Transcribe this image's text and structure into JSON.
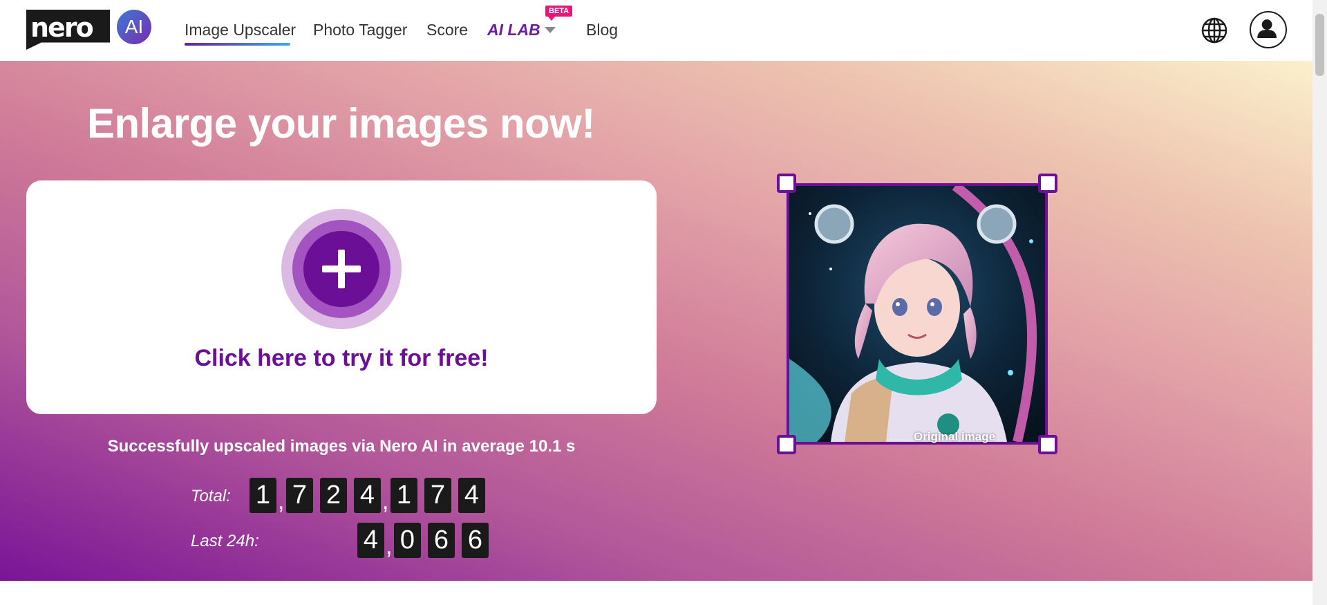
{
  "header": {
    "logo_text": "nero",
    "logo_ai": "AI",
    "nav": {
      "upscaler": "Image Upscaler",
      "tagger": "Photo Tagger",
      "score": "Score",
      "ailab": "AI LAB",
      "beta": "BETA",
      "blog": "Blog"
    },
    "icons": {
      "language": "globe-icon",
      "account": "user-icon",
      "dropdown": "chevron-down-icon"
    }
  },
  "hero": {
    "title": "Enlarge your images now!",
    "cta": "Click here to try it for free!",
    "stats_line": "Successfully upscaled images via Nero AI in average 10.1 s",
    "counters": {
      "total_label": "Total:",
      "total_digits": [
        "1",
        ",",
        "7",
        "2",
        "4",
        ",",
        "1",
        "7",
        "4"
      ],
      "last24_label": "Last 24h:",
      "last24_digits": [
        "4",
        ",",
        "0",
        "6",
        "6"
      ]
    },
    "preview_label": "Original image"
  },
  "colors": {
    "brand_purple": "#6b0f96",
    "beta_pink": "#e8157a",
    "hero_gradient_start": "#7a1497",
    "hero_gradient_end": "#fbf0cc"
  }
}
